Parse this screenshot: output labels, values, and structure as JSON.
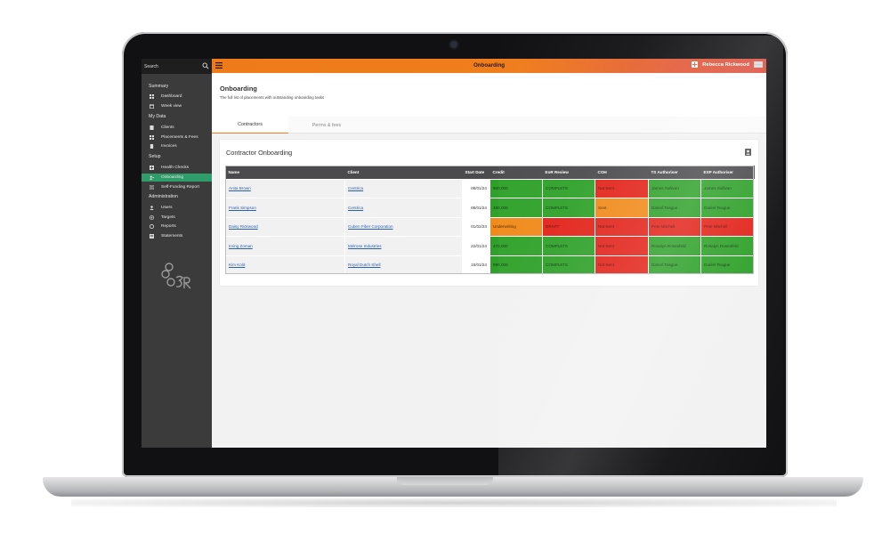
{
  "sidebar": {
    "search_placeholder": "Search",
    "sections": [
      "Summary",
      "My Data",
      "Setup",
      "Administration"
    ],
    "items": [
      {
        "label": "Dashboard",
        "icon": "grid-icon"
      },
      {
        "label": "Week view",
        "icon": "calendar-icon"
      },
      {
        "label": "Clients",
        "icon": "building-icon"
      },
      {
        "label": "Placements & Fees",
        "icon": "grid-icon"
      },
      {
        "label": "Invoices",
        "icon": "document-icon"
      },
      {
        "label": "Health Checks",
        "icon": "plus-square-icon"
      },
      {
        "label": "Onboarding",
        "icon": "onboarding-icon",
        "active": true
      },
      {
        "label": "Self-Funding Report",
        "icon": "report-icon"
      },
      {
        "label": "Users",
        "icon": "user-icon"
      },
      {
        "label": "Targets",
        "icon": "target-icon"
      },
      {
        "label": "Reports",
        "icon": "circle-icon"
      },
      {
        "label": "Statements",
        "icon": "statement-icon"
      }
    ]
  },
  "header": {
    "title": "Onboarding",
    "user_name": "Rebecca Rickwood"
  },
  "page": {
    "title": "Onboarding",
    "subtitle": "The full list of placements with outstanding onboarding tasks"
  },
  "tabs": [
    {
      "label": "Contractors",
      "active": true
    },
    {
      "label": "Perms & fees",
      "active": false
    }
  ],
  "card": {
    "title": "Contractor Onboarding",
    "columns": [
      "Name",
      "Client",
      "Start Date",
      "Credit",
      "EoR Review",
      "COH",
      "TS Authoriser",
      "EXP Authoriser"
    ],
    "rows": [
      {
        "name": "Anita Brown",
        "client": "Centrica",
        "start": "08/01/24",
        "credit": "500,000",
        "eor": "COMPLETE",
        "coh": "Not Sent",
        "ts": "James Sullivan",
        "exp": "James Sullivan"
      },
      {
        "name": "Frank Simpson",
        "client": "Centrica",
        "start": "08/01/24",
        "credit": "480,000",
        "eor": "COMPLETE",
        "coh": "Sent",
        "ts": "Daniel Teague",
        "exp": "Daniel Teague"
      },
      {
        "name": "Daisy Rickwood",
        "client": "Cuben Fiber Corporation",
        "start": "01/02/24",
        "credit": "Underwriting",
        "eor": "DRAFT",
        "coh": "Not Sent",
        "ts": "Pete Mitchell",
        "exp": "Pete Mitchell"
      },
      {
        "name": "Irving Zoman",
        "client": "Melrose Industries",
        "start": "22/01/24",
        "credit": "470,000",
        "eor": "COMPLETE",
        "coh": "Not Sent",
        "ts": "Rosalyn Rosenfeld",
        "exp": "Rosalyn Rosenfeld"
      },
      {
        "name": "Kim Kold",
        "client": "Royal Dutch Shell",
        "start": "15/01/24",
        "credit": "990,000",
        "eor": "COMPLETE",
        "coh": "Not Sent",
        "ts": "Daniel Teague",
        "exp": "Daniel Teague"
      }
    ],
    "status_colors": {
      "green": "#2fa12a",
      "red": "#e2231a",
      "orange": "#f08a1a"
    },
    "cell_status": [
      [
        "g",
        "g",
        "r",
        "g",
        "g"
      ],
      [
        "g",
        "g",
        "o",
        "g",
        "g"
      ],
      [
        "o",
        "r",
        "r",
        "r",
        "r"
      ],
      [
        "g",
        "g",
        "r",
        "g",
        "g"
      ],
      [
        "g",
        "g",
        "r",
        "g",
        "g"
      ]
    ]
  },
  "colors": {
    "accent": "#ef7e1c",
    "sidebar_bg": "#3b3b3c",
    "active_item": "#2f9d6a"
  }
}
